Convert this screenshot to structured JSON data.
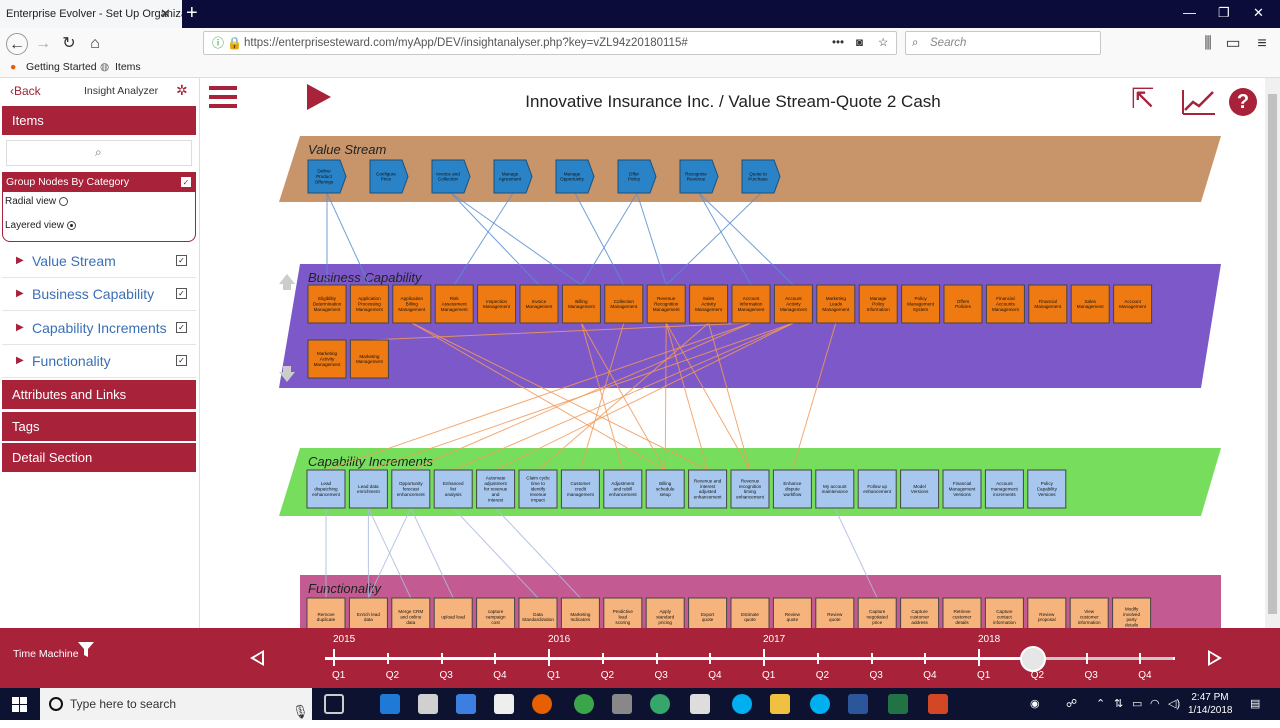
{
  "browser": {
    "tab_title": "Enterprise Evolver - Set Up Organiza",
    "url": "https://enterprisesteward.com/myApp/DEV/insightanalyser.php?key=vZL94z20180115#",
    "search_placeholder": "Search",
    "bookmarks": [
      "Getting Started",
      "Items"
    ]
  },
  "sidebar": {
    "back_label": "Back",
    "title": "Insight Analyzer",
    "items_header": "Items",
    "group_label": "Group Nodes By Category",
    "radial_label": "Radial view",
    "layered_label": "Layered view",
    "categories": [
      "Value Stream",
      "Business Capability",
      "Capability Increments",
      "Functionality"
    ],
    "sections": [
      "Attributes and Links",
      "Tags",
      "Detail Section"
    ]
  },
  "main": {
    "title": "Innovative Insurance Inc. / Value Stream-Quote 2 Cash"
  },
  "layers": {
    "value_stream": {
      "label": "Value Stream",
      "color": "#c8946a",
      "nodes": [
        "Define Product Offerings",
        "Configure Price",
        "Invoice and Collection",
        "Manage Agreement",
        "Manage Opportunity",
        "Offer Policy",
        "Recognize Revenue",
        "Quote to Purchase"
      ]
    },
    "business_capability": {
      "label": "Business Capability",
      "color": "#7c58c9",
      "nodes": [
        "Eligibility Determination Management",
        "Application Processing Management",
        "Application Billing Management",
        "Risk Assessment Management",
        "Inspection Management",
        "Invoice Management",
        "Billing Management",
        "Collection Management",
        "Revenue Recognition Management",
        "Sales Activity Management",
        "Account Information Management",
        "Account Activity Management",
        "Marketing Leads Management",
        "Manage Policy Information",
        "Policy Management System",
        "Offers Policies",
        "Financial Accounts Management",
        "Financial Management",
        "Sales Management",
        "Account Management",
        "Marketing Activity Management",
        "Marketing Management"
      ]
    },
    "capability_increments": {
      "label": "Capability Increments",
      "color": "#76de5c",
      "nodes": [
        "Lead dispatching enhancement",
        "Lead data enrichment",
        "Opportunity forecast enhancement",
        "Enhanced list analysis",
        "Automate adjustment for revenue and interest",
        "Claim cycle time to identify revenue impact",
        "Customer credit management",
        "Adjustment and rebill enhancement",
        "Billing schedule setup",
        "Revenue and interest adjusted enhancement",
        "Revenue recognition timing enhancement",
        "Enhance dispute workflow",
        "My account maintenance",
        "Follow up enhancement",
        "Model Versions",
        "Financial Management Versions",
        "Account management increments",
        "Policy Capability Versions"
      ]
    },
    "functionality": {
      "label": "Functionality",
      "color": "#c35a91",
      "nodes": [
        "Remove duplicate",
        "Enrich lead data",
        "Merge CRM and online data",
        "upload lead",
        "capture campaign cost",
        "Data Standardization",
        "Marketing Indicators",
        "Predictive lead scoring",
        "Apply standard pricing",
        "Export quote",
        "Estimate quote",
        "Review quote",
        "Review quote",
        "Capture negotiated price",
        "Capture customer address",
        "Retrieve customer details",
        "Capture contact information",
        "Review proposal",
        "View customer information",
        "Modify involved party details"
      ]
    }
  },
  "timeline": {
    "label": "Time Machine",
    "years": [
      "2015",
      "2016",
      "2017",
      "2018"
    ],
    "quarters": [
      "Q1",
      "Q2",
      "Q3",
      "Q4"
    ],
    "selected": "2018 Q2"
  },
  "taskbar": {
    "search_placeholder": "Type here to search",
    "time": "2:47 PM",
    "date": "1/14/2018"
  },
  "colors": {
    "accent": "#a8223a",
    "link": "#3a6fb5",
    "node_vs": "#2a83c6",
    "node_bc": "#f07a12",
    "node_ci": "#a7c7ee",
    "node_fn": "#f6b47c"
  }
}
